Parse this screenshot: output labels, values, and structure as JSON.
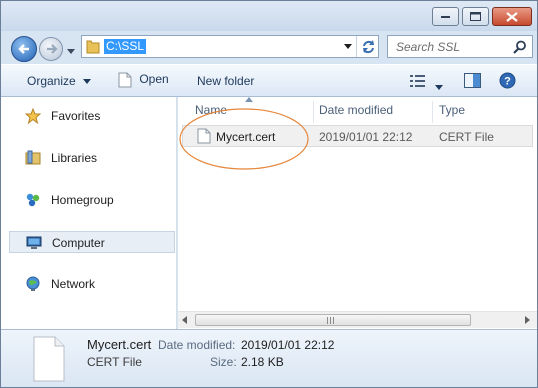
{
  "address": {
    "path": "C:\\SSL"
  },
  "search": {
    "placeholder": "Search SSL"
  },
  "toolbar": {
    "organize": "Organize",
    "open": "Open",
    "new_folder": "New folder"
  },
  "nav": {
    "items": [
      {
        "label": "Favorites"
      },
      {
        "label": "Libraries"
      },
      {
        "label": "Homegroup"
      },
      {
        "label": "Computer"
      },
      {
        "label": "Network"
      }
    ]
  },
  "list": {
    "columns": [
      "Name",
      "Date modified",
      "Type"
    ],
    "rows": [
      {
        "name": "Mycert.cert",
        "date": "2019/01/01 22:12",
        "type": "CERT File"
      }
    ]
  },
  "details": {
    "filename": "Mycert.cert",
    "filetype": "CERT File",
    "date_label": "Date modified:",
    "date_value": "2019/01/01 22:12",
    "size_label": "Size:",
    "size_value": "2.18 KB"
  },
  "colors": {
    "selection": "#3399ff",
    "highlight_ellipse": "#e6863a"
  }
}
